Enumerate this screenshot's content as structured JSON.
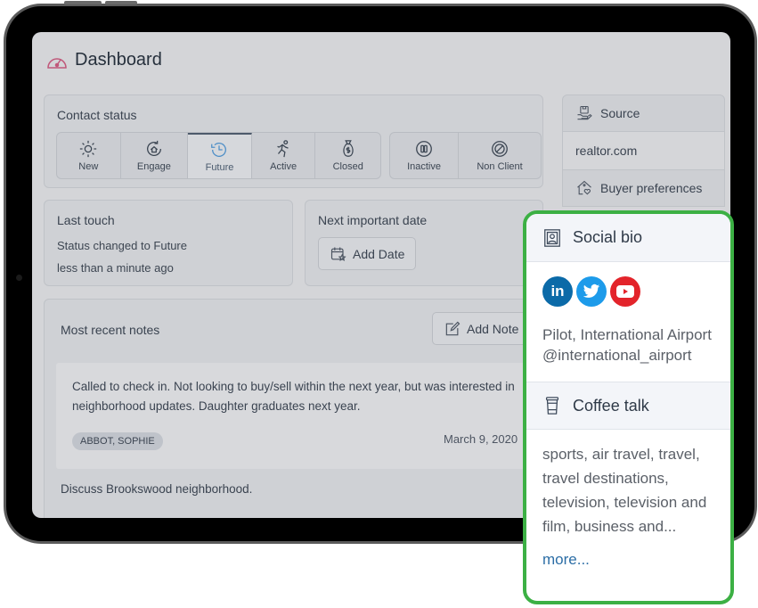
{
  "page": {
    "title": "Dashboard",
    "title_icon": "speedometer-icon"
  },
  "contact_status": {
    "label": "Contact status",
    "active": "Future",
    "group1": [
      {
        "label": "New",
        "icon": "sun-icon"
      },
      {
        "label": "Engage",
        "icon": "house-cycle-icon"
      },
      {
        "label": "Future",
        "icon": "history-clock-icon"
      },
      {
        "label": "Active",
        "icon": "running-person-icon"
      },
      {
        "label": "Closed",
        "icon": "money-bag-icon"
      }
    ],
    "group2": [
      {
        "label": "Inactive",
        "icon": "pause-circle-icon"
      },
      {
        "label": "Non Client",
        "icon": "prohibited-icon"
      }
    ]
  },
  "last_touch": {
    "label": "Last touch",
    "status": "Status changed to Future",
    "time": "less than a minute ago"
  },
  "next_date": {
    "label": "Next important date",
    "button": "Add Date"
  },
  "notes": {
    "label": "Most recent notes",
    "button": "Add Note",
    "items": [
      {
        "text": "Called to check in. Not looking to buy/sell within the next year, but was interested in neighborhood updates. Daughter graduates next year.",
        "tag": "ABBOT, SOPHIE",
        "date": "March 9, 2020"
      },
      {
        "text": "Discuss Brookswood neighborhood."
      }
    ]
  },
  "right": {
    "source_label": "Source",
    "source_value": "realtor.com",
    "buyer_prefs_label": "Buyer preferences"
  },
  "social_bio": {
    "label": "Social bio",
    "networks": [
      "LinkedIn",
      "Twitter",
      "YouTube"
    ],
    "bio_line1": "Pilot, International Airport",
    "handle": "@international_airport"
  },
  "coffee_talk": {
    "label": "Coffee talk",
    "topics": "sports, air travel, travel, travel destinations, television, television and film, business and...",
    "more_link": "more..."
  },
  "colors": {
    "highlight": "#3cb044",
    "accent": "#4f8fc7",
    "link": "#2c6ea6"
  }
}
